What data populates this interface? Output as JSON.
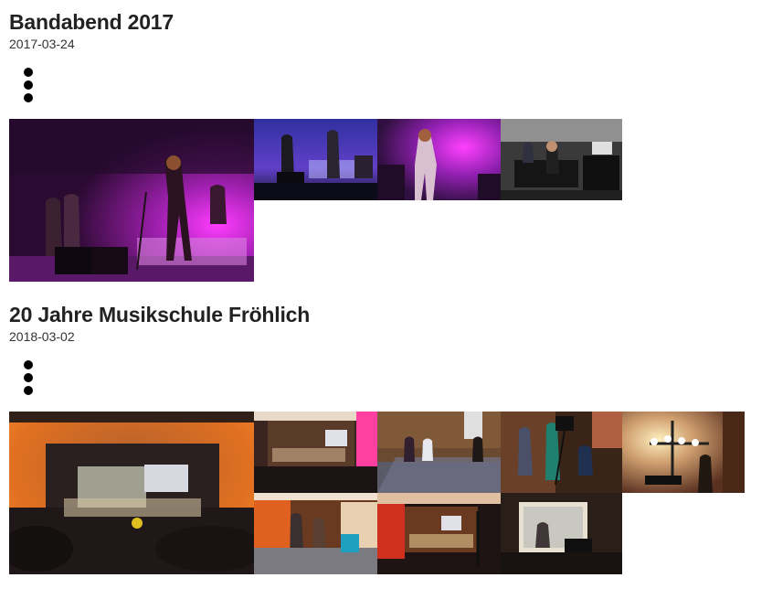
{
  "albums": [
    {
      "title": "Bandabend 2017",
      "date": "2017-03-24",
      "menu_icon": "more-vert-icon",
      "photos": [
        {
          "subject": "concert-stage-purple-lights"
        },
        {
          "subject": "band-on-stage-wide"
        },
        {
          "subject": "guitarist-close-up"
        },
        {
          "subject": "sound-desk-technicians"
        }
      ]
    },
    {
      "title": "20 Jahre Musikschule Fröhlich",
      "date": "2018-03-02",
      "menu_icon": "more-vert-icon",
      "photos": [
        {
          "subject": "concert-hall-audience-wide"
        },
        {
          "subject": "orchestra-on-stage"
        },
        {
          "subject": "hall-chairs-people"
        },
        {
          "subject": "camera-crew"
        },
        {
          "subject": "stage-light-rig"
        },
        {
          "subject": "people-in-hall-standing"
        },
        {
          "subject": "stage-with-red-lights"
        },
        {
          "subject": "projector-window"
        }
      ]
    }
  ],
  "colors": {
    "title": "#222222",
    "date": "#333333",
    "menu_dots": "#000000"
  }
}
